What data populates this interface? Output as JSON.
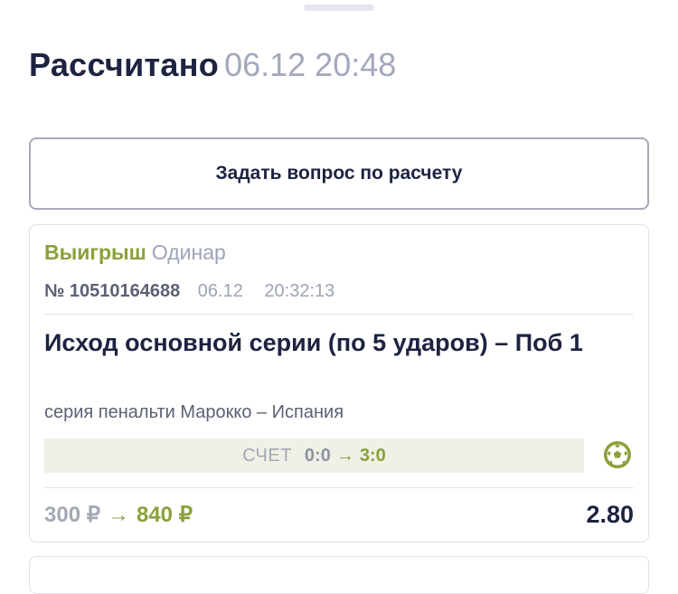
{
  "header": {
    "status": "Рассчитано",
    "datetime": "06.12 20:48"
  },
  "ask_button": {
    "label": "Задать вопрос по расчету"
  },
  "bet": {
    "result": "Выигрыш",
    "type": "Одинар",
    "number_prefix": "№",
    "number": "10510164688",
    "date": "06.12",
    "time": "20:32:13",
    "market": "Исход основной серии (по 5 ударов) – Поб 1",
    "event": "серия пенальти Марокко – Испания",
    "score_label": "СЧЕТ",
    "score_from": "0:0",
    "score_arrow": "→",
    "score_to": "3:0",
    "sport_icon": "football-icon",
    "stake": "300 ₽",
    "amount_arrow": "→",
    "payout": "840 ₽",
    "odds": "2.80"
  },
  "colors": {
    "accent_green": "#8aa03a",
    "text_dark": "#1d2340",
    "text_muted": "#a3a8bd"
  }
}
